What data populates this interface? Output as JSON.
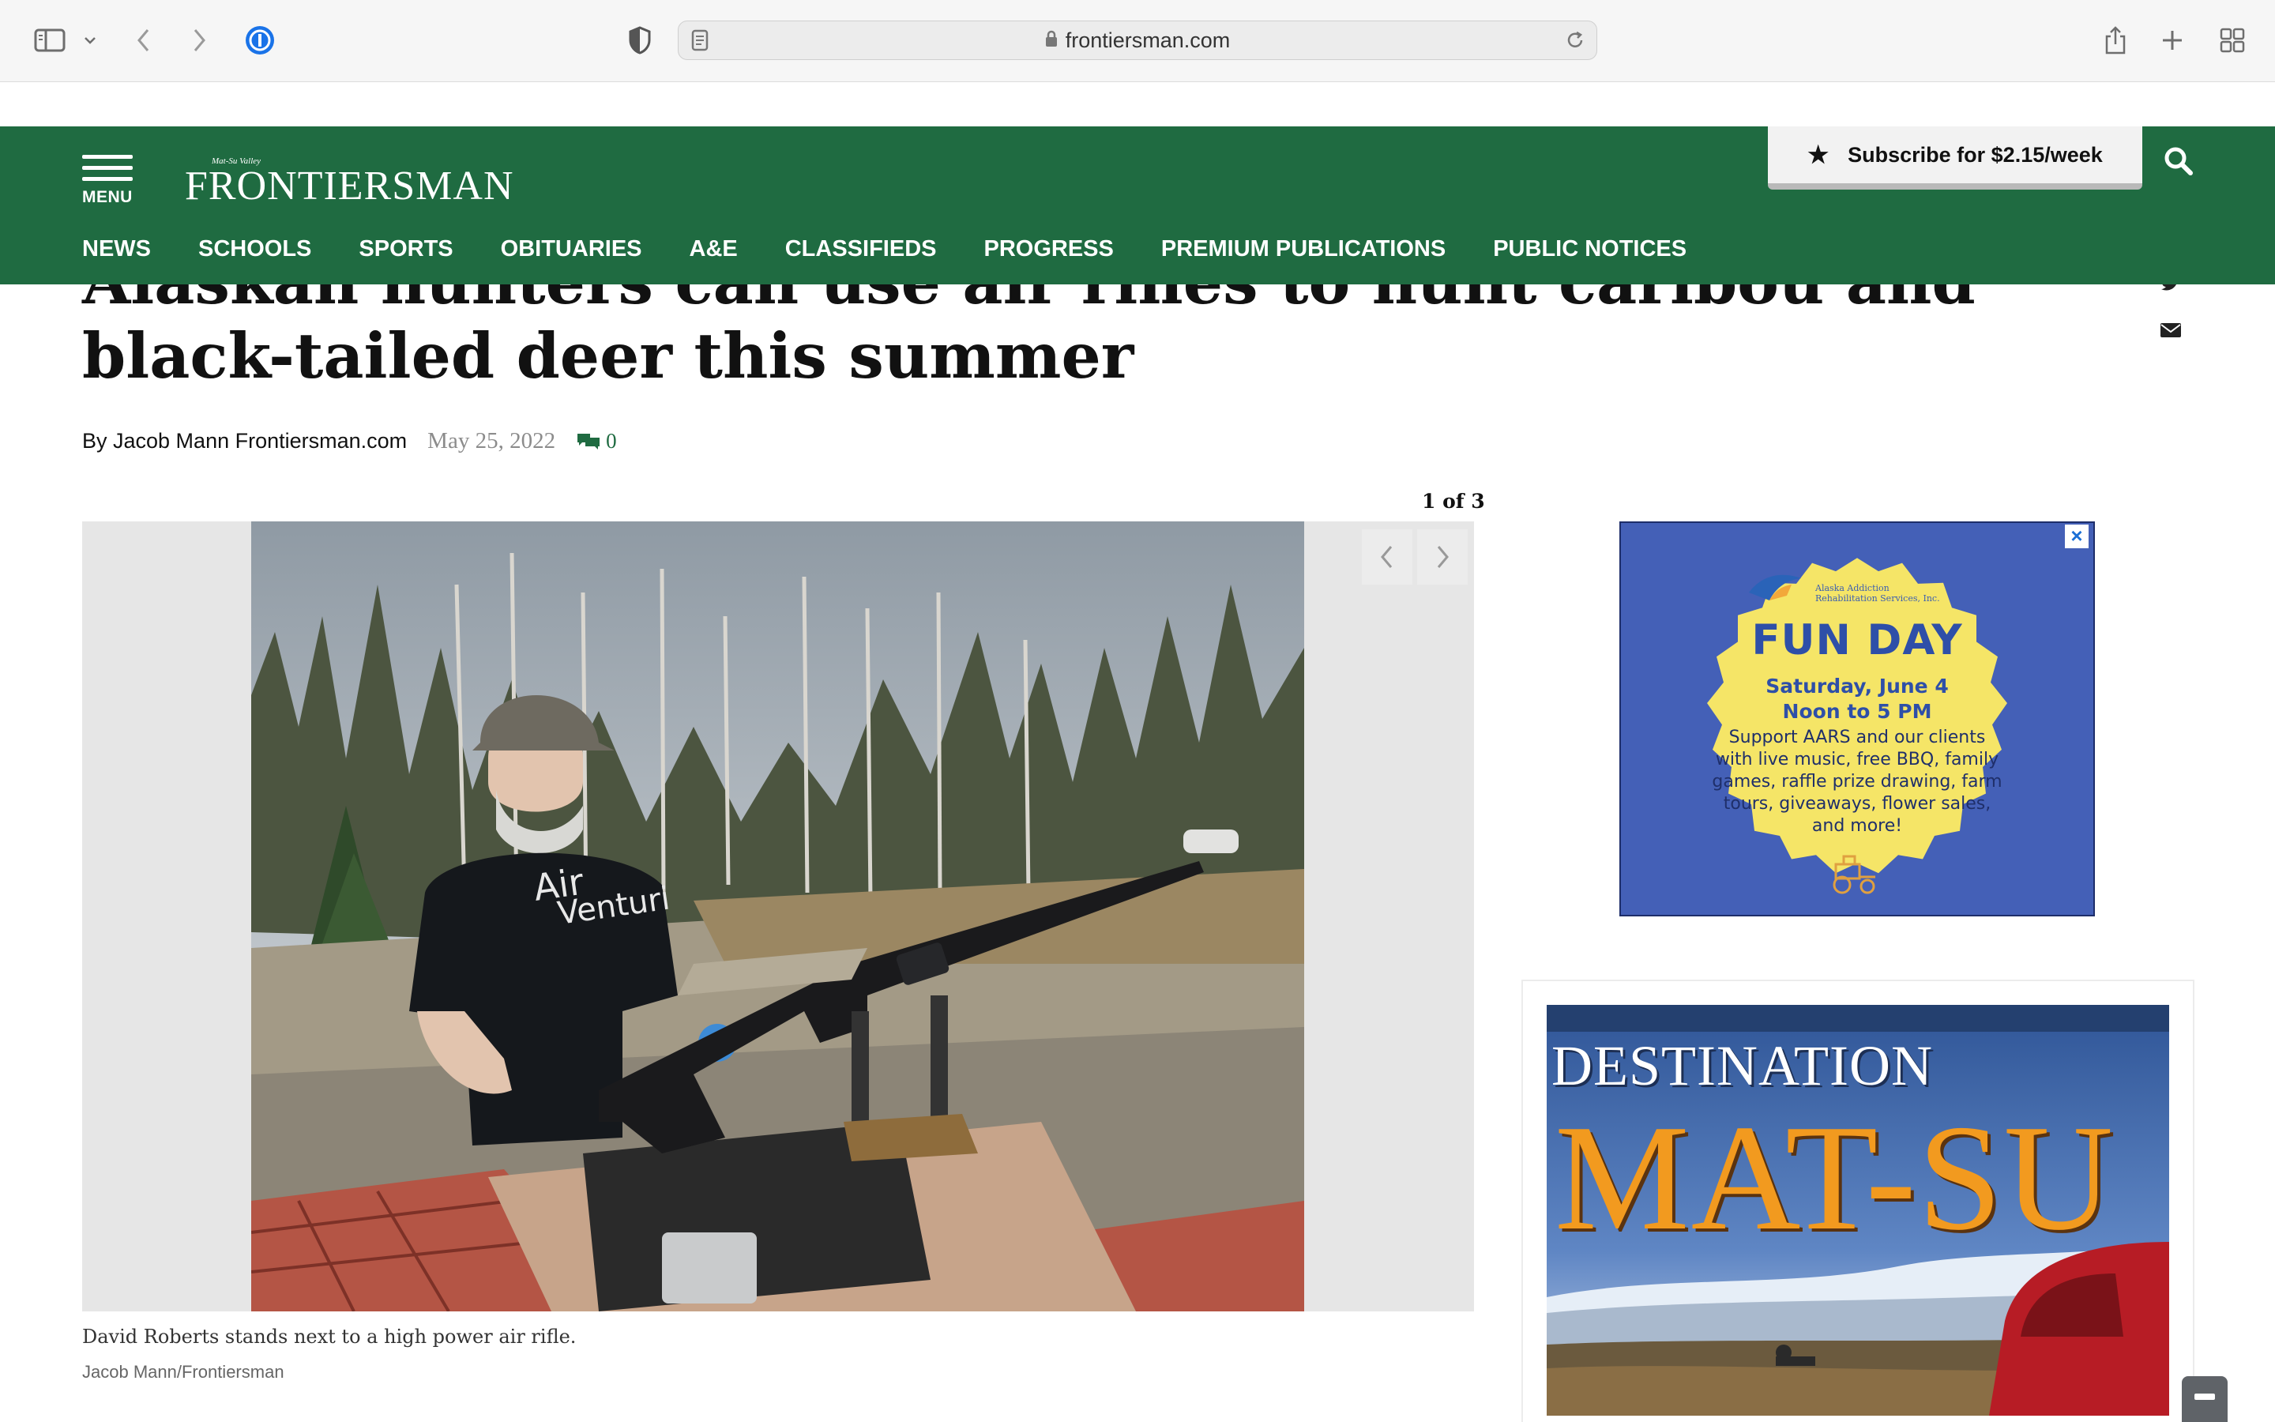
{
  "browser": {
    "url": "frontiersman.com"
  },
  "header": {
    "menu_label": "MENU",
    "logo_small": "Mat-Su Valley",
    "logo_name": "FRONTIERSMAN",
    "subscribe_label": "Subscribe for $2.15/week",
    "nav": [
      "NEWS",
      "SCHOOLS",
      "SPORTS",
      "OBITUARIES",
      "A&E",
      "CLASSIFIEDS",
      "PROGRESS",
      "PREMIUM PUBLICATIONS",
      "PUBLIC NOTICES"
    ],
    "colors": {
      "brand": "#1f6b41"
    }
  },
  "article": {
    "headline": "Alaskan hunters can use air rifles to hunt caribou and black-tailed deer this summer",
    "author": "By Jacob Mann Frontiersman.com",
    "date": "May 25, 2022",
    "comment_count": "0",
    "gallery_counter": "1 of 3",
    "caption": "David Roberts stands next to a high power air rifle.",
    "credit": "Jacob Mann/Frontiersman",
    "shirt_text_1": "Air",
    "shirt_text_2": "Venturi"
  },
  "ads": {
    "fun_day": {
      "org": "Alaska Addiction Rehabilitation Services, Inc.",
      "title": "FUN DAY",
      "date": "Saturday, June 4",
      "time": "Noon to 5 PM",
      "body": "Support AARS and our clients with live music, free BBQ, family games, raffle prize drawing, farm tours, giveaways, flower sales, and more!"
    },
    "destination": {
      "line1": "DESTINATION",
      "line2": "MAT-SU"
    }
  }
}
